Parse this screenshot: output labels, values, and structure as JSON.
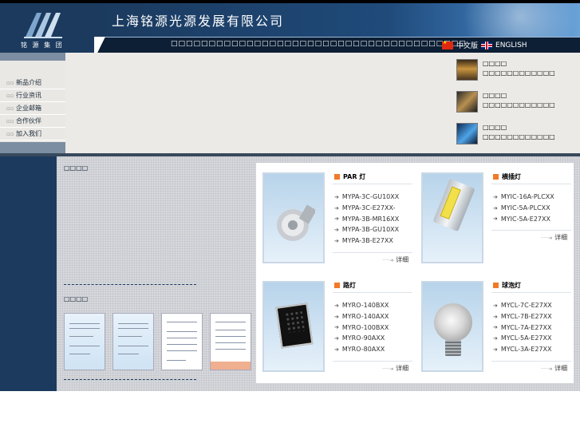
{
  "header": {
    "logo_text": "铭 源 集 团",
    "company_name": "上海铭源光源发展有限公司",
    "marquee": "□□□□□□□□□□□□□□□□□□□□□□□□□□□□□□□□□□□□□□□",
    "lang_cn": "中文版",
    "lang_en": "ENGLISH"
  },
  "sidebar": {
    "items": [
      {
        "label": "新品介绍"
      },
      {
        "label": "行业资讯"
      },
      {
        "label": "企业邮箱"
      },
      {
        "label": "合作伙伴"
      },
      {
        "label": "加入我们"
      }
    ]
  },
  "news": [
    {
      "title": "□□□□",
      "desc": "□□□□□□□□□□□□"
    },
    {
      "title": "□□□□",
      "desc": "□□□□□□□□□□□□"
    },
    {
      "title": "□□□□",
      "desc": "□□□□□□□□□□□□"
    }
  ],
  "left_sections": {
    "first_title": "□□□□",
    "second_title": "□□□□"
  },
  "products": [
    {
      "name": "PAR 灯",
      "items": [
        "MYPA-3C-GU10XX",
        "MYPA-3C-E27XX-",
        "MYPA-3B-MR16XX",
        "MYPA-3B-GU10XX",
        "MYPA-3B-E27XX"
      ],
      "more": "详细"
    },
    {
      "name": "横插灯",
      "items": [
        "MYIC-16A-PLCXX",
        "MYIC-5A-PLCXX",
        "MYIC-5A-E27XX"
      ],
      "more": "详细"
    },
    {
      "name": "路灯",
      "items": [
        "MYRO-140BXX",
        "MYRO-140AXX",
        "MYRO-100BXX",
        "MYRO-90AXX",
        "MYRO-80AXX"
      ],
      "more": "详细"
    },
    {
      "name": "球泡灯",
      "items": [
        "MYCL-7C-E27XX",
        "MYCL-7B-E27XX",
        "MYCL-7A-E27XX",
        "MYCL-5A-E27XX",
        "MYCL-3A-E27XX"
      ],
      "more": "详细"
    }
  ],
  "colors": {
    "navy": "#1b3a5e",
    "accent": "#f07a2a"
  }
}
